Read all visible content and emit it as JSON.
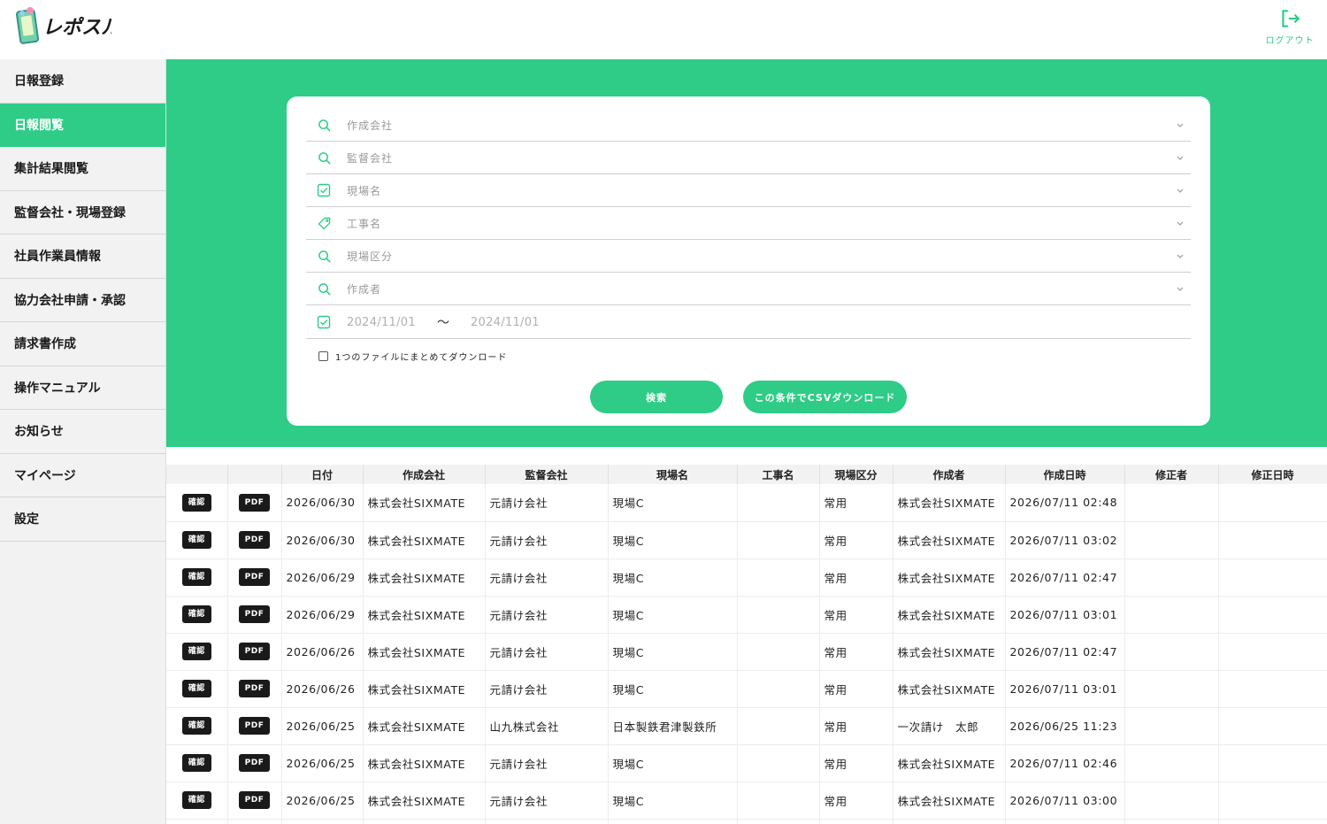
{
  "app": {
    "name": "レポスル",
    "brand_color": "#2ecc87"
  },
  "header": {
    "logout_label": "ログアウト",
    "logout_icon": "logout-icon"
  },
  "sidebar": {
    "items": [
      {
        "label": "日報登録",
        "active": false
      },
      {
        "label": "日報閲覧",
        "active": true
      },
      {
        "label": "集計結果閲覧",
        "active": false
      },
      {
        "label": "監督会社・現場登録",
        "active": false
      },
      {
        "label": "社員作業員情報",
        "active": false
      },
      {
        "label": "協力会社申請・承認",
        "active": false
      },
      {
        "label": "請求書作成",
        "active": false
      },
      {
        "label": "操作マニュアル",
        "active": false
      },
      {
        "label": "お知らせ",
        "active": false
      },
      {
        "label": "マイページ",
        "active": false
      },
      {
        "label": "設定",
        "active": false
      }
    ]
  },
  "filters": {
    "company": {
      "label": "作成会社",
      "icon": "search-icon"
    },
    "supervisor": {
      "label": "監督会社",
      "icon": "search-icon"
    },
    "site": {
      "label": "現場名",
      "icon": "checkbox-icon"
    },
    "construction": {
      "label": "工事名",
      "icon": "tag-icon"
    },
    "site_type": {
      "label": "現場区分",
      "icon": "search-icon"
    },
    "creator": {
      "label": "作成者",
      "icon": "search-icon"
    },
    "date_from": "2024/11/01",
    "date_tilde": "〜",
    "date_to": "2024/11/01",
    "single_file_label": "1つのファイルにまとめてダウンロード",
    "single_file_checked": false,
    "search_button": "検索",
    "csv_button": "この条件でCSVダウンロード"
  },
  "table": {
    "headers": [
      "",
      "",
      "日付",
      "作成会社",
      "監督会社",
      "現場名",
      "工事名",
      "現場区分",
      "作成者",
      "作成日時",
      "修正者",
      "修正日時"
    ],
    "confirm_label": "確認",
    "pdf_label": "PDF",
    "rows": [
      [
        "2026/06/30",
        "株式会社SIXMATE",
        "元請け会社",
        "現場C",
        "",
        "常用",
        "株式会社SIXMATE",
        "2026/07/11 02:48",
        "",
        ""
      ],
      [
        "2026/06/30",
        "株式会社SIXMATE",
        "元請け会社",
        "現場C",
        "",
        "常用",
        "株式会社SIXMATE",
        "2026/07/11 03:02",
        "",
        ""
      ],
      [
        "2026/06/29",
        "株式会社SIXMATE",
        "元請け会社",
        "現場C",
        "",
        "常用",
        "株式会社SIXMATE",
        "2026/07/11 02:47",
        "",
        ""
      ],
      [
        "2026/06/29",
        "株式会社SIXMATE",
        "元請け会社",
        "現場C",
        "",
        "常用",
        "株式会社SIXMATE",
        "2026/07/11 03:01",
        "",
        ""
      ],
      [
        "2026/06/26",
        "株式会社SIXMATE",
        "元請け会社",
        "現場C",
        "",
        "常用",
        "株式会社SIXMATE",
        "2026/07/11 02:47",
        "",
        ""
      ],
      [
        "2026/06/26",
        "株式会社SIXMATE",
        "元請け会社",
        "現場C",
        "",
        "常用",
        "株式会社SIXMATE",
        "2026/07/11 03:01",
        "",
        ""
      ],
      [
        "2026/06/25",
        "株式会社SIXMATE",
        "山九株式会社",
        "日本製鉄君津製鉄所",
        "",
        "常用",
        "一次請け　太郎",
        "2026/06/25 11:23",
        "",
        ""
      ],
      [
        "2026/06/25",
        "株式会社SIXMATE",
        "元請け会社",
        "現場C",
        "",
        "常用",
        "株式会社SIXMATE",
        "2026/07/11 02:46",
        "",
        ""
      ],
      [
        "2026/06/25",
        "株式会社SIXMATE",
        "元請け会社",
        "現場C",
        "",
        "常用",
        "株式会社SIXMATE",
        "2026/07/11 03:00",
        "",
        ""
      ],
      [
        "",
        "",
        "",
        "",
        "",
        "",
        "",
        "",
        "",
        ""
      ]
    ]
  }
}
